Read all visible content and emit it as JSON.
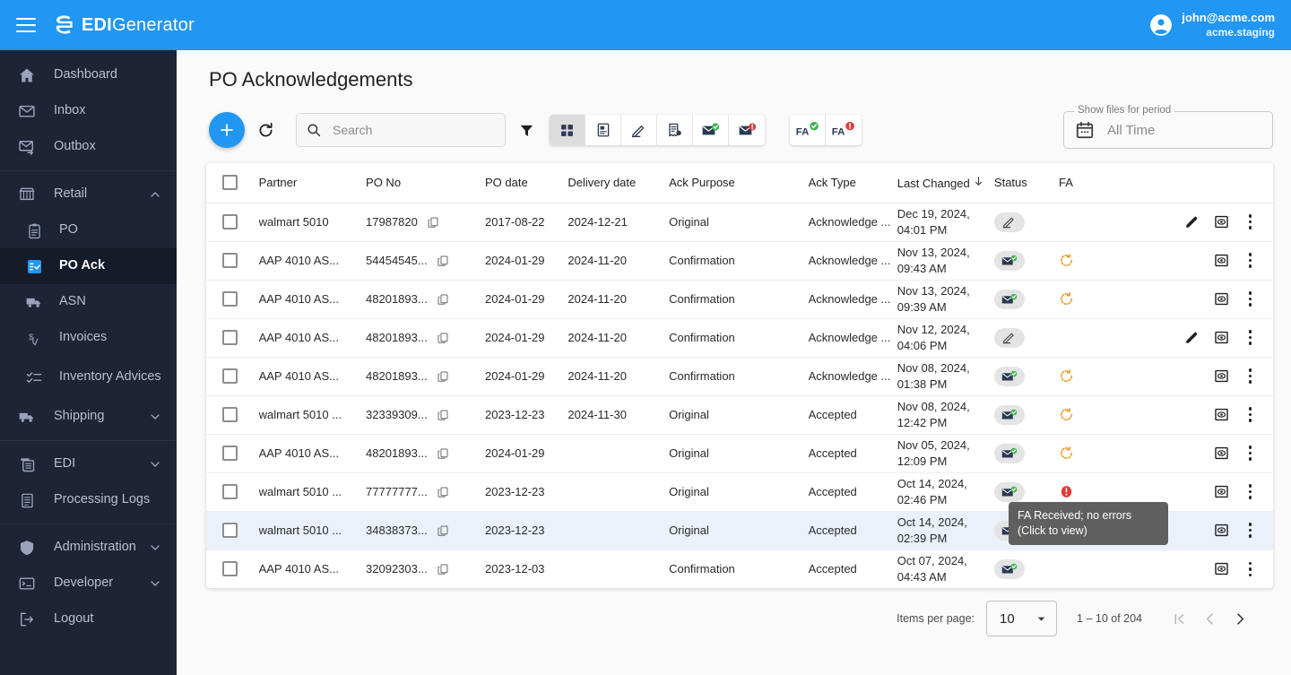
{
  "topbar": {
    "menu_icon": "hamburger-icon",
    "logo_bold": "EDI",
    "logo_rest": "Generator",
    "user_email": "john@acme.com",
    "user_tenant": "acme.staging"
  },
  "sidebar": {
    "items": [
      {
        "label": "Dashboard",
        "icon": "home-icon",
        "level": "top"
      },
      {
        "label": "Inbox",
        "icon": "inbox-envelope-icon",
        "level": "top"
      },
      {
        "label": "Outbox",
        "icon": "outbox-envelope-icon",
        "level": "top"
      },
      {
        "label": "Retail",
        "icon": "store-icon",
        "level": "top",
        "expandable": true,
        "expanded": true
      },
      {
        "label": "PO",
        "icon": "clipboard-icon",
        "level": "sub"
      },
      {
        "label": "PO Ack",
        "icon": "po-ack-icon",
        "level": "sub",
        "active": true
      },
      {
        "label": "ASN",
        "icon": "truck-icon",
        "level": "sub"
      },
      {
        "label": "Invoices",
        "icon": "invoice-icon",
        "level": "sub"
      },
      {
        "label": "Inventory Advices",
        "icon": "checklist-icon",
        "level": "sub"
      },
      {
        "label": "Shipping",
        "icon": "truck-icon",
        "level": "top",
        "expandable": true
      },
      {
        "label": "EDI",
        "icon": "edi-grid-icon",
        "level": "top",
        "expandable": true
      },
      {
        "label": "Processing Logs",
        "icon": "logs-icon",
        "level": "top"
      },
      {
        "label": "Administration",
        "icon": "shield-icon",
        "level": "top",
        "expandable": true
      },
      {
        "label": "Developer",
        "icon": "terminal-icon",
        "level": "top",
        "expandable": true
      },
      {
        "label": "Logout",
        "icon": "logout-icon",
        "level": "top"
      }
    ]
  },
  "page": {
    "title": "PO Acknowledgements"
  },
  "toolbar": {
    "add_label": "+",
    "refresh_icon": "refresh-icon",
    "search_placeholder": "Search",
    "search_value": "",
    "filter_icon": "filter-icon",
    "view_buttons": [
      {
        "name": "grid-view",
        "icon": "grid-icon",
        "selected": true
      },
      {
        "name": "document-view",
        "icon": "document-icon",
        "selected": false
      },
      {
        "name": "edit-view",
        "icon": "pencil-icon",
        "selected": false
      },
      {
        "name": "receipt-view",
        "icon": "receipt-settings-icon",
        "selected": false
      },
      {
        "name": "sent-ok",
        "icon": "envelope-check-icon",
        "selected": false
      },
      {
        "name": "sent-error",
        "icon": "envelope-error-icon",
        "selected": false
      }
    ],
    "fa_buttons": [
      {
        "name": "fa-ok",
        "label": "FA",
        "badge": "green"
      },
      {
        "name": "fa-error",
        "label": "FA",
        "badge": "red"
      }
    ],
    "period": {
      "legend": "Show files for period",
      "value": "All Time",
      "icon": "calendar-icon"
    }
  },
  "table": {
    "columns": [
      "",
      "Partner",
      "PO No",
      "PO date",
      "Delivery date",
      "Ack Purpose",
      "Ack Type",
      "Last Changed",
      "Status",
      "FA",
      ""
    ],
    "sort_column": "Last Changed",
    "sort_direction": "desc",
    "rows": [
      {
        "partner": "walmart 5010",
        "po_no": "17987820",
        "po_date": "2017-08-22",
        "delivery_date": "2024-12-21",
        "ack_purpose": "Original",
        "ack_type": "Acknowledge ...",
        "changed_date": "Dec 19, 2024,",
        "changed_time": "04:01 PM",
        "status": "draft",
        "fa": "none",
        "has_edit": true,
        "highlight": false
      },
      {
        "partner": "AAP 4010 AS...",
        "po_no": "54454545...",
        "po_date": "2024-01-29",
        "delivery_date": "2024-11-20",
        "ack_purpose": "Confirmation",
        "ack_type": "Acknowledge ...",
        "changed_date": "Nov 13, 2024,",
        "changed_time": "09:43 AM",
        "status": "sent",
        "fa": "pending",
        "has_edit": false,
        "highlight": false
      },
      {
        "partner": "AAP 4010 AS...",
        "po_no": "48201893...",
        "po_date": "2024-01-29",
        "delivery_date": "2024-11-20",
        "ack_purpose": "Confirmation",
        "ack_type": "Acknowledge ...",
        "changed_date": "Nov 13, 2024,",
        "changed_time": "09:39 AM",
        "status": "sent",
        "fa": "pending",
        "has_edit": false,
        "highlight": false
      },
      {
        "partner": "AAP 4010 AS...",
        "po_no": "48201893...",
        "po_date": "2024-01-29",
        "delivery_date": "2024-11-20",
        "ack_purpose": "Confirmation",
        "ack_type": "Acknowledge ...",
        "changed_date": "Nov 12, 2024,",
        "changed_time": "04:06 PM",
        "status": "draft",
        "fa": "none",
        "has_edit": true,
        "highlight": false
      },
      {
        "partner": "AAP 4010 AS...",
        "po_no": "48201893...",
        "po_date": "2024-01-29",
        "delivery_date": "2024-11-20",
        "ack_purpose": "Confirmation",
        "ack_type": "Acknowledge ...",
        "changed_date": "Nov 08, 2024,",
        "changed_time": "01:38 PM",
        "status": "sent",
        "fa": "pending",
        "has_edit": false,
        "highlight": false
      },
      {
        "partner": "walmart 5010 ...",
        "po_no": "32339309...",
        "po_date": "2023-12-23",
        "delivery_date": "2024-11-30",
        "ack_purpose": "Original",
        "ack_type": "Accepted",
        "changed_date": "Nov 08, 2024,",
        "changed_time": "12:42 PM",
        "status": "sent",
        "fa": "pending",
        "has_edit": false,
        "highlight": false
      },
      {
        "partner": "AAP 4010 AS...",
        "po_no": "48201893...",
        "po_date": "2024-01-29",
        "delivery_date": "",
        "ack_purpose": "Original",
        "ack_type": "Accepted",
        "changed_date": "Nov 05, 2024,",
        "changed_time": "12:09 PM",
        "status": "sent",
        "fa": "pending",
        "has_edit": false,
        "highlight": false
      },
      {
        "partner": "walmart 5010 ...",
        "po_no": "77777777...",
        "po_date": "2023-12-23",
        "delivery_date": "",
        "ack_purpose": "Original",
        "ack_type": "Accepted",
        "changed_date": "Oct 14, 2024,",
        "changed_time": "02:46 PM",
        "status": "sent",
        "fa": "error",
        "has_edit": false,
        "highlight": false
      },
      {
        "partner": "walmart 5010 ...",
        "po_no": "34838373...",
        "po_date": "2023-12-23",
        "delivery_date": "",
        "ack_purpose": "Original",
        "ack_type": "Accepted",
        "changed_date": "Oct 14, 2024,",
        "changed_time": "02:39 PM",
        "status": "sent",
        "fa": "ok",
        "has_edit": false,
        "highlight": true
      },
      {
        "partner": "AAP 4010 AS...",
        "po_no": "32092303...",
        "po_date": "2023-12-03",
        "delivery_date": "",
        "ack_purpose": "Confirmation",
        "ack_type": "Accepted",
        "changed_date": "Oct 07, 2024,",
        "changed_time": "04:43 AM",
        "status": "sent",
        "fa": "none",
        "has_edit": false,
        "highlight": false
      }
    ]
  },
  "tooltip": {
    "text": "FA Received; no errors (Click to view)"
  },
  "pagination": {
    "items_per_page_label": "Items per page:",
    "items_per_page_value": "10",
    "range_label": "1 – 10 of 204",
    "first_icon": "first-page-icon",
    "prev_icon": "prev-page-icon",
    "next_icon": "next-page-icon"
  },
  "colors": {
    "brand_blue": "#2196f3",
    "sidebar_bg": "#1e2435",
    "accent_green": "#3cb54a",
    "accent_red": "#e53935",
    "accent_orange": "#e89c2a"
  }
}
